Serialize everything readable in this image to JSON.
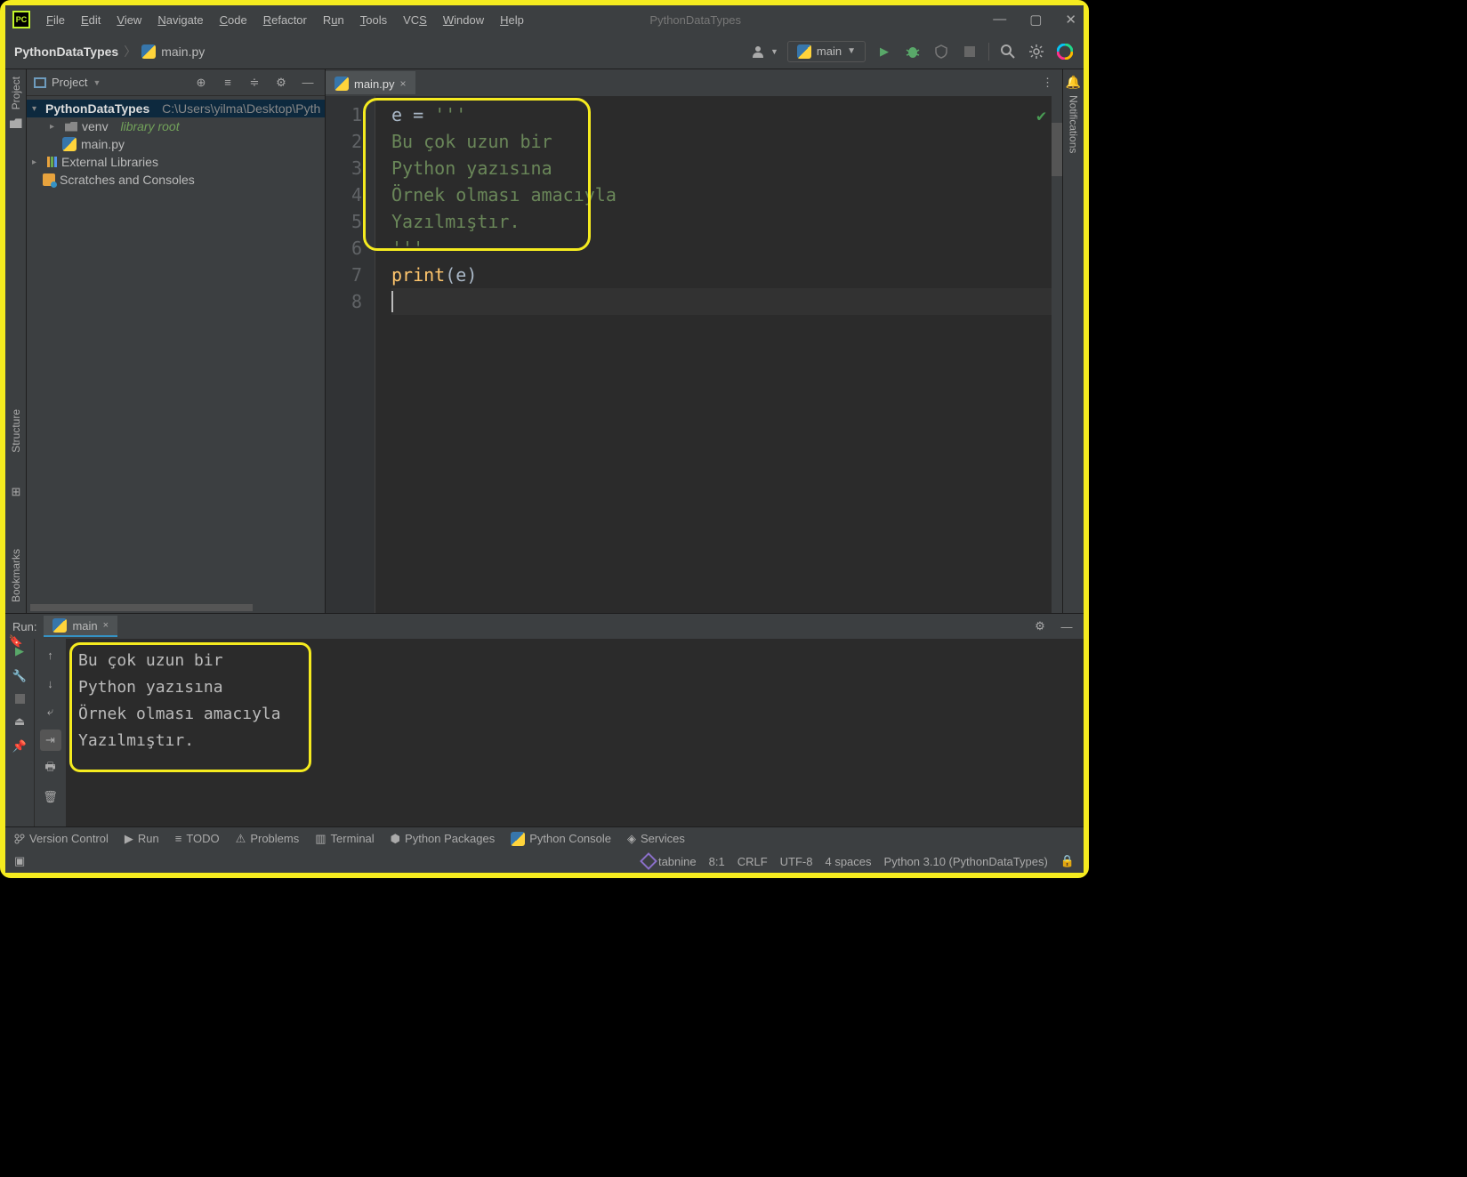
{
  "window": {
    "appname": "PythonDataTypes"
  },
  "menus": [
    "File",
    "Edit",
    "View",
    "Navigate",
    "Code",
    "Refactor",
    "Run",
    "Tools",
    "VCS",
    "Window",
    "Help"
  ],
  "breadcrumb": {
    "root": "PythonDataTypes",
    "file": "main.py"
  },
  "runConfig": {
    "name": "main"
  },
  "sidebar": {
    "projectLabel": "Project"
  },
  "tree": {
    "root": {
      "name": "PythonDataTypes",
      "path": "C:\\Users\\yilma\\Desktop\\Pyth"
    },
    "venv": {
      "name": "venv",
      "tag": "library root"
    },
    "main": {
      "name": "main.py"
    },
    "ext": {
      "name": "External Libraries"
    },
    "scr": {
      "name": "Scratches and Consoles"
    }
  },
  "editor": {
    "tab": "main.py",
    "lines": [
      "1",
      "2",
      "3",
      "4",
      "5",
      "6",
      "7",
      "8"
    ],
    "code": {
      "l1a": "e ",
      "l1b": "= ",
      "l1c": "'''",
      "l2": "Bu çok uzun bir",
      "l3": "Python yazısına",
      "l4": "Örnek olması amacıyla",
      "l5": "Yazılmıştır.",
      "l6": "'''",
      "l7a": "print",
      "l7b": "(",
      "l7c": "e",
      "l7d": ")"
    }
  },
  "run": {
    "label": "Run:",
    "tab": "main",
    "output": [
      "Bu çok uzun bir",
      "Python yazısına",
      "Örnek olması amacıyla",
      "Yazılmıştır."
    ]
  },
  "rails": {
    "project": "Project",
    "notifications": "Notifications",
    "structure": "Structure",
    "bookmarks": "Bookmarks"
  },
  "bottombar": {
    "vc": "Version Control",
    "run": "Run",
    "todo": "TODO",
    "problems": "Problems",
    "terminal": "Terminal",
    "pypkg": "Python Packages",
    "pycon": "Python Console",
    "services": "Services"
  },
  "status": {
    "tabnine": "tabnine",
    "pos": "8:1",
    "eol": "CRLF",
    "enc": "UTF-8",
    "indent": "4 spaces",
    "interp": "Python 3.10 (PythonDataTypes)"
  }
}
